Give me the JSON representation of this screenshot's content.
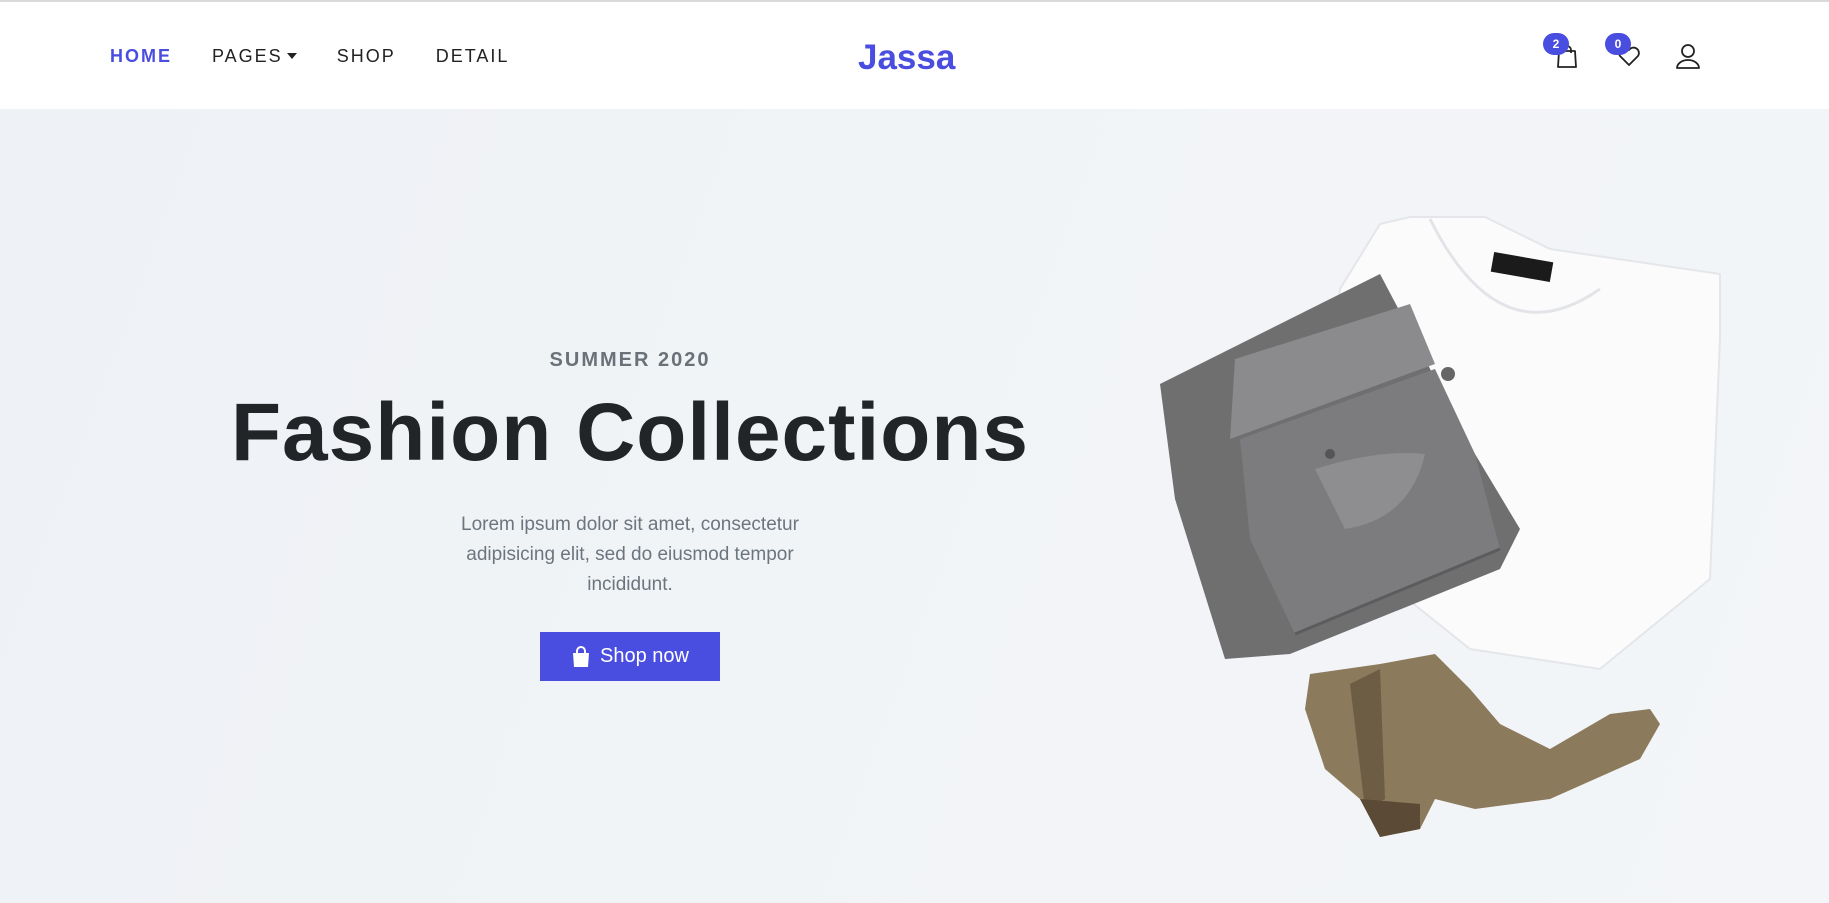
{
  "nav": {
    "items": [
      {
        "label": "HOME"
      },
      {
        "label": "PAGES"
      },
      {
        "label": "SHOP"
      },
      {
        "label": "DETAIL"
      }
    ]
  },
  "brand": {
    "name": "Jassa"
  },
  "header_icons": {
    "cart": {
      "count": "2",
      "icon": "shopping-bag-icon"
    },
    "wishlist": {
      "count": "0",
      "icon": "heart-icon"
    },
    "account": {
      "icon": "user-icon"
    }
  },
  "hero": {
    "kicker": "SUMMER 2020",
    "title": "Fashion Collections",
    "description": "Lorem ipsum dolor sit amet, consectetur adipisicing elit, sed do eiusmod tempor incididunt.",
    "cta_label": "Shop now",
    "cta_icon": "shopping-bag-icon"
  },
  "colors": {
    "accent": "#4a4ee0",
    "text_dark": "#222528",
    "text_muted": "#6c757d",
    "hero_bg": "#eef1f5"
  }
}
